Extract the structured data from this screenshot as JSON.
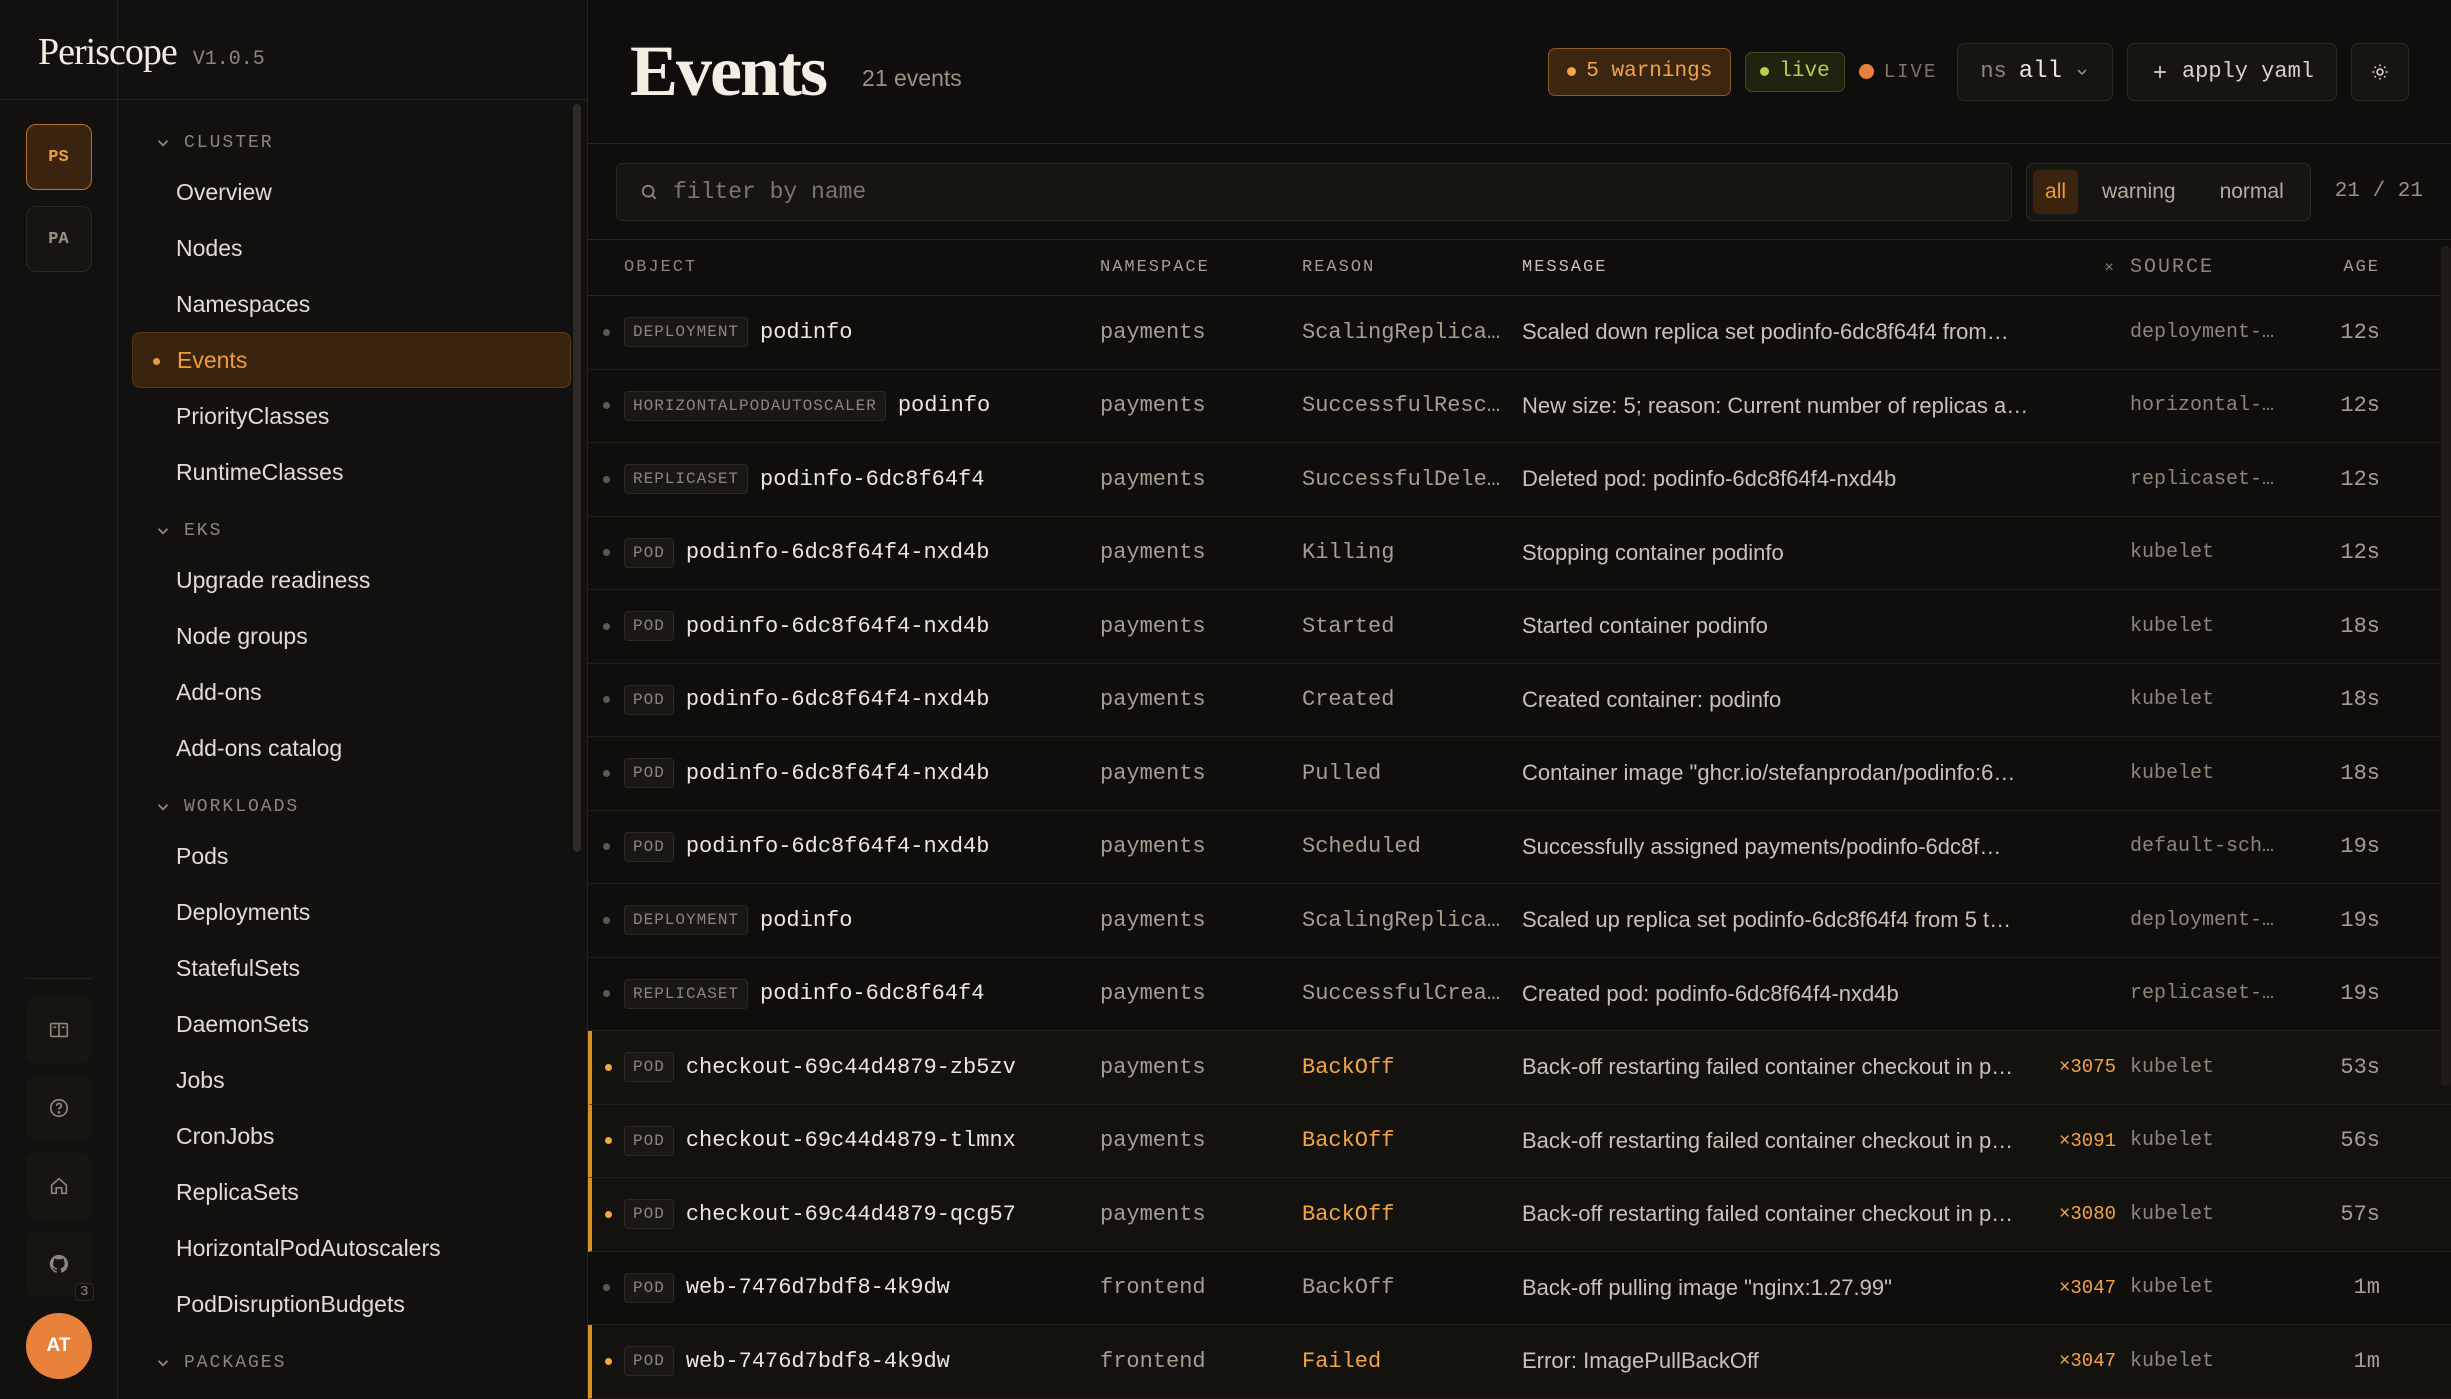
{
  "app": {
    "name": "Periscope",
    "version": "V1.0.5"
  },
  "rail": {
    "contexts": [
      "PS",
      "PA"
    ],
    "github_badge": "3",
    "avatar": "AT"
  },
  "nav": {
    "groups": [
      {
        "label": "CLUSTER",
        "items": [
          "Overview",
          "Nodes",
          "Namespaces",
          "Events",
          "PriorityClasses",
          "RuntimeClasses"
        ]
      },
      {
        "label": "EKS",
        "items": [
          "Upgrade readiness",
          "Node groups",
          "Add-ons",
          "Add-ons catalog"
        ]
      },
      {
        "label": "WORKLOADS",
        "items": [
          "Pods",
          "Deployments",
          "StatefulSets",
          "DaemonSets",
          "Jobs",
          "CronJobs",
          "ReplicaSets",
          "HorizontalPodAutoscalers",
          "PodDisruptionBudgets"
        ]
      },
      {
        "label": "PACKAGES",
        "items": []
      }
    ],
    "active": "Events"
  },
  "header": {
    "title": "Events",
    "count": "21 events",
    "warnings": "5 warnings",
    "live_pill": "live",
    "live_tag": "LIVE",
    "ns_label": "ns",
    "ns_value": "all",
    "apply": "apply yaml"
  },
  "filter": {
    "placeholder": "filter by name",
    "segments": [
      "all",
      "warning",
      "normal"
    ],
    "selected": "all",
    "tally": "21 / 21"
  },
  "columns": {
    "object": "OBJECT",
    "namespace": "NAMESPACE",
    "reason": "REASON",
    "message": "MESSAGE",
    "count": "×",
    "source": "SOURCE",
    "age": "AGE"
  },
  "colors": {
    "accent": "#f09a3e",
    "warning": "#f3a446",
    "live": "#b8d04a"
  },
  "events": [
    {
      "kind": "DEPLOYMENT",
      "name": "podinfo",
      "namespace": "payments",
      "reason": "ScalingReplica…",
      "message": "Scaled down replica set podinfo-6dc8f64f4 from…",
      "count": "",
      "source": "deployment-…",
      "age": "12s",
      "warning": false
    },
    {
      "kind": "HORIZONTALPODAUTOSCALER",
      "name": "podinfo",
      "namespace": "payments",
      "reason": "SuccessfulResc…",
      "message": "New size: 5; reason: Current number of replicas a…",
      "count": "",
      "source": "horizontal-…",
      "age": "12s",
      "warning": false
    },
    {
      "kind": "REPLICASET",
      "name": "podinfo-6dc8f64f4",
      "namespace": "payments",
      "reason": "SuccessfulDele…",
      "message": "Deleted pod: podinfo-6dc8f64f4-nxd4b",
      "count": "",
      "source": "replicaset-…",
      "age": "12s",
      "warning": false
    },
    {
      "kind": "POD",
      "name": "podinfo-6dc8f64f4-nxd4b",
      "namespace": "payments",
      "reason": "Killing",
      "message": "Stopping container podinfo",
      "count": "",
      "source": "kubelet",
      "age": "12s",
      "warning": false
    },
    {
      "kind": "POD",
      "name": "podinfo-6dc8f64f4-nxd4b",
      "namespace": "payments",
      "reason": "Started",
      "message": "Started container podinfo",
      "count": "",
      "source": "kubelet",
      "age": "18s",
      "warning": false
    },
    {
      "kind": "POD",
      "name": "podinfo-6dc8f64f4-nxd4b",
      "namespace": "payments",
      "reason": "Created",
      "message": "Created container: podinfo",
      "count": "",
      "source": "kubelet",
      "age": "18s",
      "warning": false
    },
    {
      "kind": "POD",
      "name": "podinfo-6dc8f64f4-nxd4b",
      "namespace": "payments",
      "reason": "Pulled",
      "message": "Container image \"ghcr.io/stefanprodan/podinfo:6…",
      "count": "",
      "source": "kubelet",
      "age": "18s",
      "warning": false
    },
    {
      "kind": "POD",
      "name": "podinfo-6dc8f64f4-nxd4b",
      "namespace": "payments",
      "reason": "Scheduled",
      "message": "Successfully assigned payments/podinfo-6dc8f…",
      "count": "",
      "source": "default-sch…",
      "age": "19s",
      "warning": false
    },
    {
      "kind": "DEPLOYMENT",
      "name": "podinfo",
      "namespace": "payments",
      "reason": "ScalingReplica…",
      "message": "Scaled up replica set podinfo-6dc8f64f4 from 5 t…",
      "count": "",
      "source": "deployment-…",
      "age": "19s",
      "warning": false
    },
    {
      "kind": "REPLICASET",
      "name": "podinfo-6dc8f64f4",
      "namespace": "payments",
      "reason": "SuccessfulCrea…",
      "message": "Created pod: podinfo-6dc8f64f4-nxd4b",
      "count": "",
      "source": "replicaset-…",
      "age": "19s",
      "warning": false
    },
    {
      "kind": "POD",
      "name": "checkout-69c44d4879-zb5zv",
      "namespace": "payments",
      "reason": "BackOff",
      "message": "Back-off restarting failed container checkout in p…",
      "count": "×3075",
      "source": "kubelet",
      "age": "53s",
      "warning": true
    },
    {
      "kind": "POD",
      "name": "checkout-69c44d4879-tlmnx",
      "namespace": "payments",
      "reason": "BackOff",
      "message": "Back-off restarting failed container checkout in p…",
      "count": "×3091",
      "source": "kubelet",
      "age": "56s",
      "warning": true
    },
    {
      "kind": "POD",
      "name": "checkout-69c44d4879-qcg57",
      "namespace": "payments",
      "reason": "BackOff",
      "message": "Back-off restarting failed container checkout in p…",
      "count": "×3080",
      "source": "kubelet",
      "age": "57s",
      "warning": true
    },
    {
      "kind": "POD",
      "name": "web-7476d7bdf8-4k9dw",
      "namespace": "frontend",
      "reason": "BackOff",
      "message": "Back-off pulling image \"nginx:1.27.99\"",
      "count": "×3047",
      "source": "kubelet",
      "age": "1m",
      "warning": false
    },
    {
      "kind": "POD",
      "name": "web-7476d7bdf8-4k9dw",
      "namespace": "frontend",
      "reason": "Failed",
      "message": "Error: ImagePullBackOff",
      "count": "×3047",
      "source": "kubelet",
      "age": "1m",
      "warning": true
    }
  ]
}
